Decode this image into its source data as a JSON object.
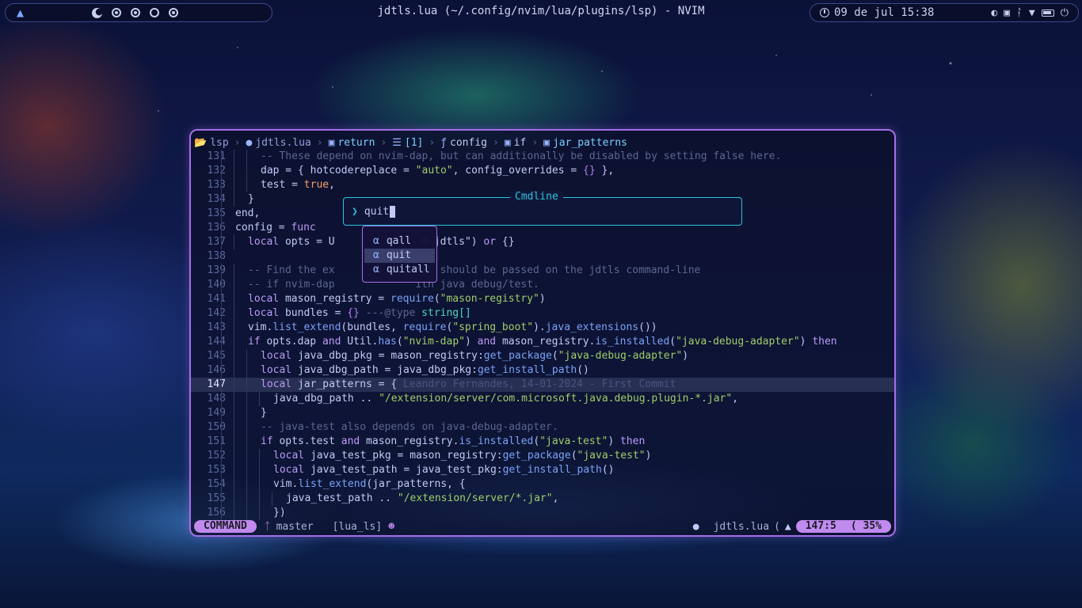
{
  "topbar": {
    "window_title": "jdtls.lua (~/.config/nvim/lua/plugins/lsp) - NVIM",
    "clock": "09 de jul 15:38",
    "workspaces": [
      "ws1",
      "ws2",
      "ws3",
      "ws4",
      "ws5"
    ]
  },
  "winbar": {
    "items": [
      "lsp",
      "jdtls.lua",
      "return",
      "[1]",
      "config",
      "if",
      "jar_patterns"
    ]
  },
  "code_lines": [
    {
      "n": "131",
      "indent": 4,
      "html": "<span class=\"cm\">-- These depend on nvim-dap, but can additionally be disabled by setting false here.</span>"
    },
    {
      "n": "132",
      "indent": 4,
      "html": "dap = { hotcodereplace = <span class=\"str\">\"auto\"</span>, config_overrides = <span class=\"bl\">{}</span> },"
    },
    {
      "n": "133",
      "indent": 4,
      "html": "test = <span class=\"tf\">true</span>,"
    },
    {
      "n": "134",
      "indent": 3,
      "html": "}"
    },
    {
      "n": "135",
      "indent": 2,
      "html": "end,"
    },
    {
      "n": "136",
      "indent": 2,
      "html": "config = <span class=\"kw\">func</span>"
    },
    {
      "n": "137",
      "indent": 3,
      "html": "<span class=\"kw\">local</span> opts = U              m-jdtls\") <span class=\"kw\">or</span> {}"
    },
    {
      "n": "138",
      "indent": 0,
      "html": ""
    },
    {
      "n": "139",
      "indent": 3,
      "html": "<span class=\"cm\">-- Find the ex             hat should be passed on the jdtls command-line</span>"
    },
    {
      "n": "140",
      "indent": 3,
      "html": "<span class=\"cm\">-- if nvim-dap             ith java debug/test.</span>"
    },
    {
      "n": "141",
      "indent": 3,
      "html": "<span class=\"kw\">local</span> mason_registry = <span class=\"fn\">require</span>(<span class=\"str\">\"mason-registry\"</span>)"
    },
    {
      "n": "142",
      "indent": 3,
      "html": "<span class=\"kw\">local</span> bundles = <span class=\"bl\">{}</span> <span class=\"cm\">---@type</span> <span class=\"ty\">string[]</span>"
    },
    {
      "n": "143",
      "indent": 3,
      "html": "vim.<span class=\"fn\">list_extend</span>(bundles, <span class=\"fn\">require</span>(<span class=\"str\">\"spring_boot\"</span>).<span class=\"fn\">java_extensions</span>())"
    },
    {
      "n": "144",
      "indent": 3,
      "html": "<span class=\"kw\">if</span> opts.dap <span class=\"kw\">and</span> Util.<span class=\"fn\">has</span>(<span class=\"str\">\"nvim-dap\"</span>) <span class=\"kw\">and</span> mason_registry.<span class=\"fn\">is_installed</span>(<span class=\"str\">\"java-debug-adapter\"</span>) <span class=\"kw\">then</span>"
    },
    {
      "n": "145",
      "indent": 4,
      "html": "<span class=\"kw\">local</span> java_dbg_pkg = mason_registry:<span class=\"fn\">get_package</span>(<span class=\"str\">\"java-debug-adapter\"</span>)"
    },
    {
      "n": "146",
      "indent": 4,
      "html": "<span class=\"kw\">local</span> java_dbg_path = java_dbg_pkg:<span class=\"fn\">get_install_path</span>()"
    },
    {
      "n": "147",
      "indent": 4,
      "cur": true,
      "html": "<span class=\"kw\">local</span> jar_patterns = { <span class=\"blame\">Leandro Fernandes, 14-01-2024 - First Commit</span>"
    },
    {
      "n": "148",
      "indent": 5,
      "html": "java_dbg_path .. <span class=\"str\">\"/extension/server/com.microsoft.java.debug.plugin-*.jar\"</span>,"
    },
    {
      "n": "149",
      "indent": 4,
      "html": "}"
    },
    {
      "n": "150",
      "indent": 4,
      "html": "<span class=\"cm\">-- java-test also depends on java-debug-adapter.</span>"
    },
    {
      "n": "151",
      "indent": 4,
      "html": "<span class=\"kw\">if</span> opts.test <span class=\"kw\">and</span> mason_registry.<span class=\"fn\">is_installed</span>(<span class=\"str\">\"java-test\"</span>) <span class=\"kw\">then</span>"
    },
    {
      "n": "152",
      "indent": 5,
      "html": "<span class=\"kw\">local</span> java_test_pkg = mason_registry:<span class=\"fn\">get_package</span>(<span class=\"str\">\"java-test\"</span>)"
    },
    {
      "n": "153",
      "indent": 5,
      "html": "<span class=\"kw\">local</span> java_test_path = java_test_pkg:<span class=\"fn\">get_install_path</span>()"
    },
    {
      "n": "154",
      "indent": 5,
      "html": "vim.<span class=\"fn\">list_extend</span>(jar_patterns, {"
    },
    {
      "n": "155",
      "indent": 6,
      "html": "java_test_path .. <span class=\"str\">\"/extension/server/*.jar\"</span>,"
    },
    {
      "n": "156",
      "indent": 5,
      "html": "})"
    }
  ],
  "cmdline": {
    "title": "Cmdline",
    "value": "quit"
  },
  "completion": {
    "items": [
      "qall",
      "quit",
      "quitall"
    ],
    "selected": 1
  },
  "statusline": {
    "mode": "COMMAND",
    "branch": "master",
    "lsp": "[lua_ls]",
    "filename": "jdtls.lua",
    "position": "147:5",
    "percent": "35%"
  },
  "colors": {
    "accent": "#c08aee",
    "cmdline_border": "#2ac3de",
    "window_border": "#a46fe6"
  }
}
